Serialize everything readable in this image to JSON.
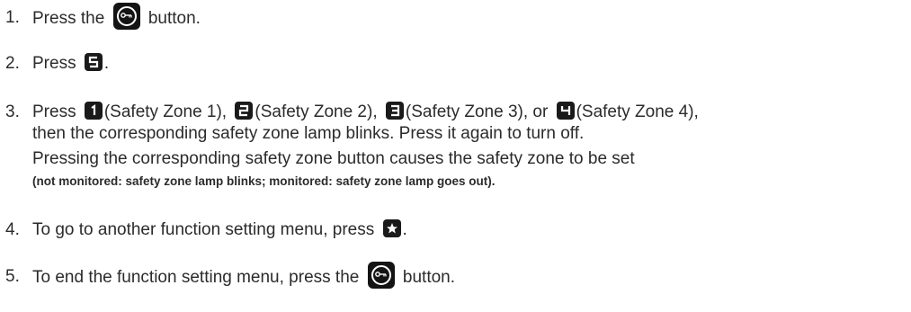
{
  "steps": [
    {
      "number": "1.",
      "text_before": "Press the",
      "icon": "function-key-icon",
      "text_after": "button."
    },
    {
      "number": "2.",
      "text_before": "Press",
      "icon": "key-5-icon",
      "text_after": "."
    },
    {
      "number": "3.",
      "line1": {
        "press": "Press",
        "zone1": "(Safety Zone 1),",
        "zone2": "(Safety Zone 2),",
        "zone3": "(Safety Zone 3), or",
        "zone4": "(Safety Zone 4),"
      },
      "line2": "then the corresponding safety zone lamp blinks. Press it again to turn off.",
      "line3": "Pressing the corresponding safety zone button causes the safety zone to be set",
      "line4": "(not monitored: safety zone lamp blinks; monitored: safety zone lamp goes out)."
    },
    {
      "number": "4.",
      "text_before": "To go to another function setting menu, press",
      "icon": "asterisk-key-icon",
      "text_after": "."
    },
    {
      "number": "5.",
      "text_before": "To end the function setting menu, press the",
      "icon": "function-key-icon",
      "text_after": "button."
    }
  ]
}
